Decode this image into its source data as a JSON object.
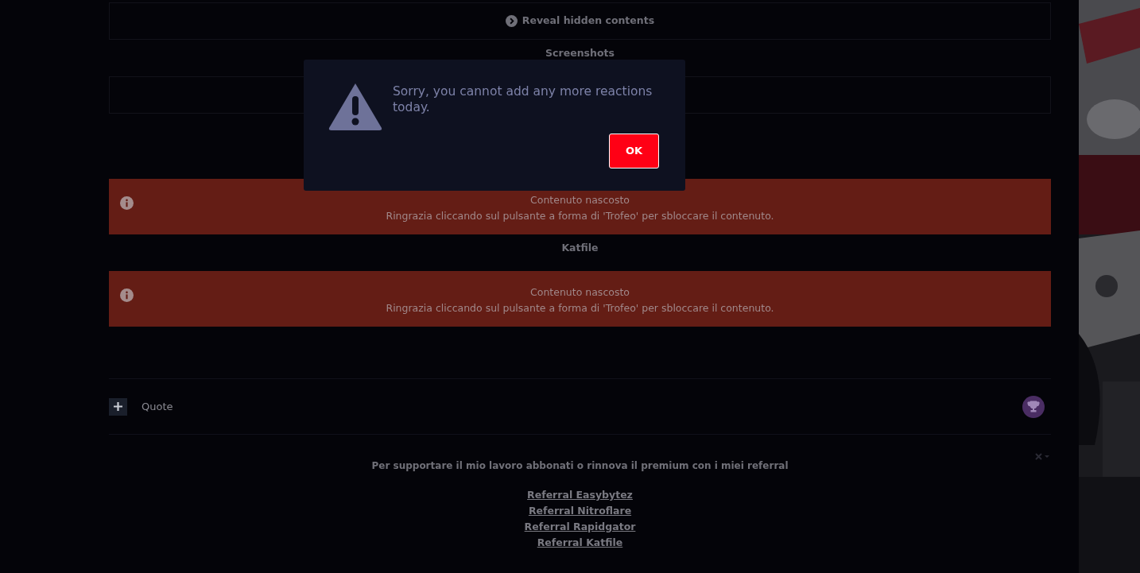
{
  "blocks": [
    {
      "kind": "spoiler",
      "label": "Reveal hidden contents"
    },
    {
      "kind": "heading",
      "text": "Screenshots"
    },
    {
      "kind": "empty_box"
    },
    {
      "kind": "notice",
      "title": "Contenuto nascosto",
      "message": "Ringrazia cliccando sul pulsante a forma di 'Trofeo' per sbloccare il contenuto."
    },
    {
      "kind": "heading",
      "text": "Katfile"
    },
    {
      "kind": "notice",
      "title": "Contenuto nascosto",
      "message": "Ringrazia cliccando sul pulsante a forma di 'Trofeo' per sbloccare il contenuto."
    }
  ],
  "quote_bar": {
    "label": "Quote"
  },
  "signature": {
    "text": "Per supportare il mio lavoro abbonati o rinnova il premium con i miei referral",
    "links": [
      "Referral Easybytez",
      "Referral Nitroflare",
      "Referral Rapidgator",
      "Referral Katfile"
    ]
  },
  "dialog": {
    "message": "Sorry, you cannot add any more reactions today.",
    "button": "OK"
  }
}
